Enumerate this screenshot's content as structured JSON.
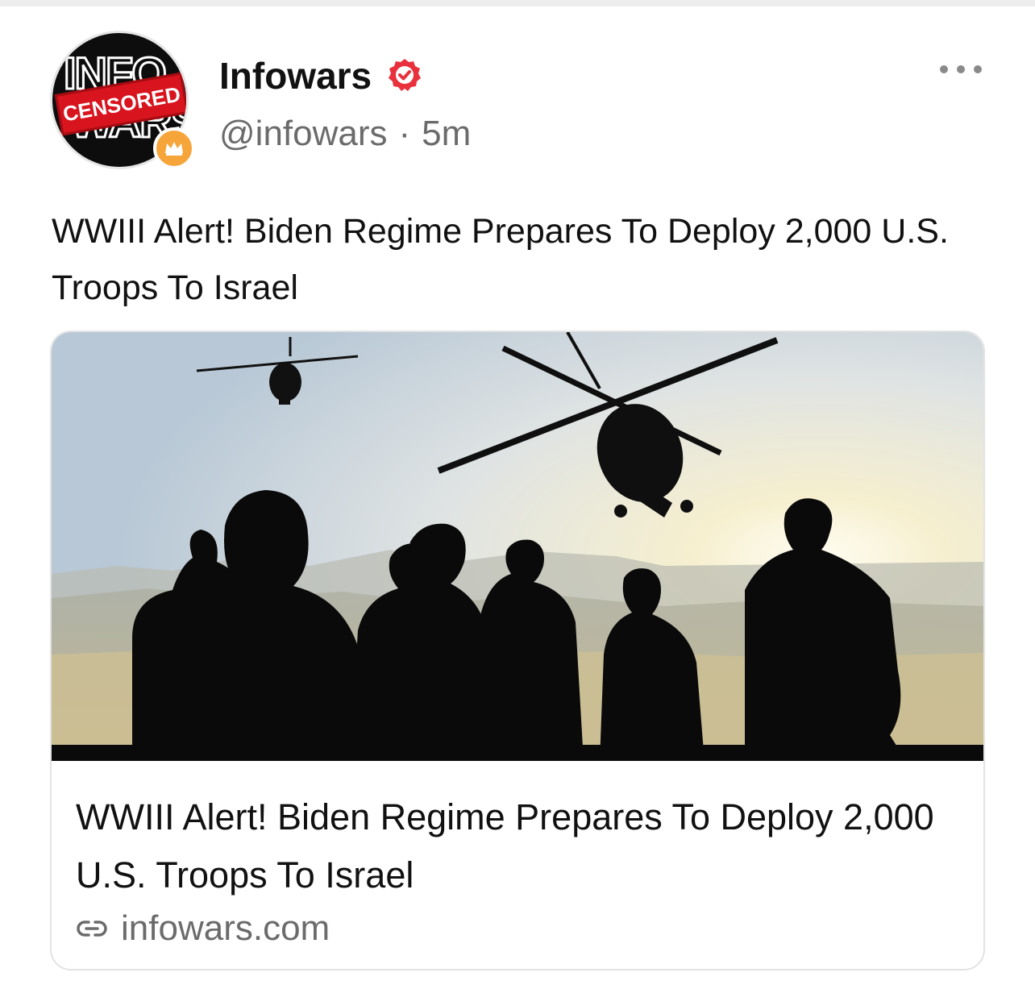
{
  "post": {
    "author": {
      "display_name": "Infowars",
      "handle": "@infowars",
      "separator": "·",
      "time_ago": "5m",
      "verified": true,
      "avatar": {
        "logo_top": "INFO",
        "logo_bottom": "WARS",
        "stamp_text": "CENSORED",
        "badge_icon": "crown-icon"
      }
    },
    "text": "WWIII Alert! Biden Regime Prepares To Deploy 2,000 U.S. Troops To Israel",
    "more_icon": "more-horizontal-icon",
    "link_card": {
      "image_icon": "article-image",
      "title": "WWIII Alert! Biden Regime Prepares To Deploy 2,000 U.S. Troops To Israel",
      "domain": "infowars.com",
      "link_icon": "link-icon"
    }
  },
  "colors": {
    "verified": "#e8313c",
    "badge": "#f6a53a",
    "secondary_text": "#6b6b6b",
    "stamp": "#d8141e"
  }
}
